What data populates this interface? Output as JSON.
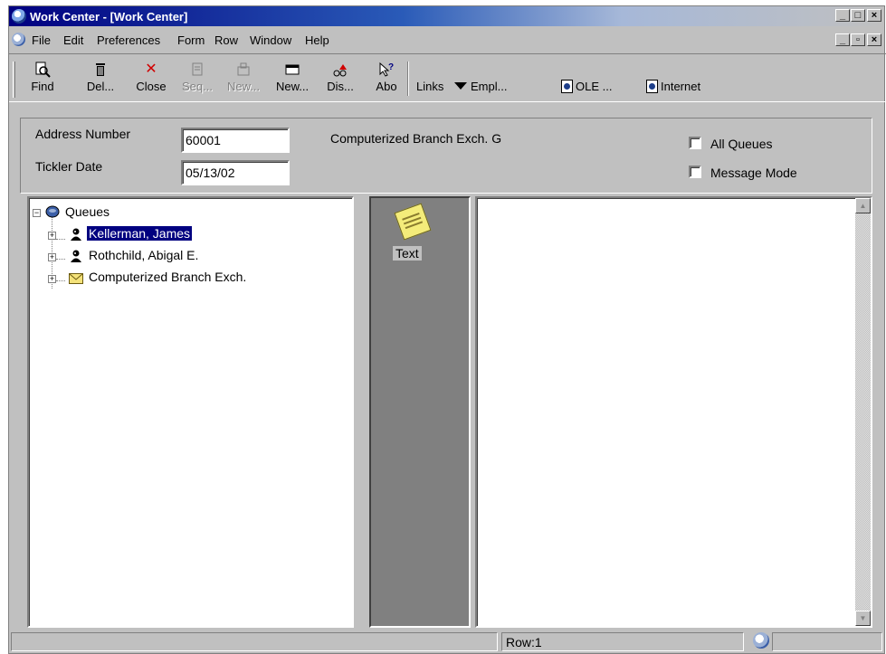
{
  "window": {
    "title": "Work Center - [Work Center]",
    "controls": [
      "_",
      "□",
      "×"
    ],
    "mdi_controls": [
      "_",
      "▫",
      "×"
    ]
  },
  "menu": {
    "items": [
      "File",
      "Edit",
      "Preferences",
      "Form",
      "Row",
      "Window",
      "Help"
    ]
  },
  "toolbar": {
    "buttons": [
      {
        "label": "Find",
        "icon": "find-icon",
        "enabled": true
      },
      {
        "label": "Del...",
        "icon": "delete-icon",
        "enabled": true
      },
      {
        "label": "Close",
        "icon": "close-icon",
        "enabled": true
      },
      {
        "label": "Seq...",
        "icon": "sequence-icon",
        "enabled": false
      },
      {
        "label": "New...",
        "icon": "new-disabled-icon",
        "enabled": false
      },
      {
        "label": "New...",
        "icon": "new-message-icon",
        "enabled": true
      },
      {
        "label": "Dis...",
        "icon": "display-icon",
        "enabled": true
      },
      {
        "label": "Abo",
        "icon": "about-icon",
        "enabled": true
      }
    ],
    "links_label": "Links",
    "links": [
      "Empl...",
      "OLE ...",
      "Internet"
    ]
  },
  "header": {
    "address_number_label": "Address Number",
    "address_number_value": "60001",
    "address_description": "Computerized Branch Exch. G",
    "tickler_date_label": "Tickler Date",
    "tickler_date_value": "05/13/02",
    "all_queues_label": "All Queues",
    "message_mode_label": "Message Mode",
    "all_queues_checked": false,
    "message_mode_checked": false
  },
  "tree": {
    "root_label": "Queues",
    "items": [
      {
        "label": "Kellerman, James",
        "icon": "person-icon",
        "selected": true
      },
      {
        "label": "Rothchild, Abigal E.",
        "icon": "person-icon",
        "selected": false
      },
      {
        "label": "Computerized Branch Exch.",
        "icon": "envelope-icon",
        "selected": false
      }
    ]
  },
  "middle": {
    "note_label": "Text",
    "note_icon": "note-icon"
  },
  "status": {
    "row_text": "Row:1"
  }
}
